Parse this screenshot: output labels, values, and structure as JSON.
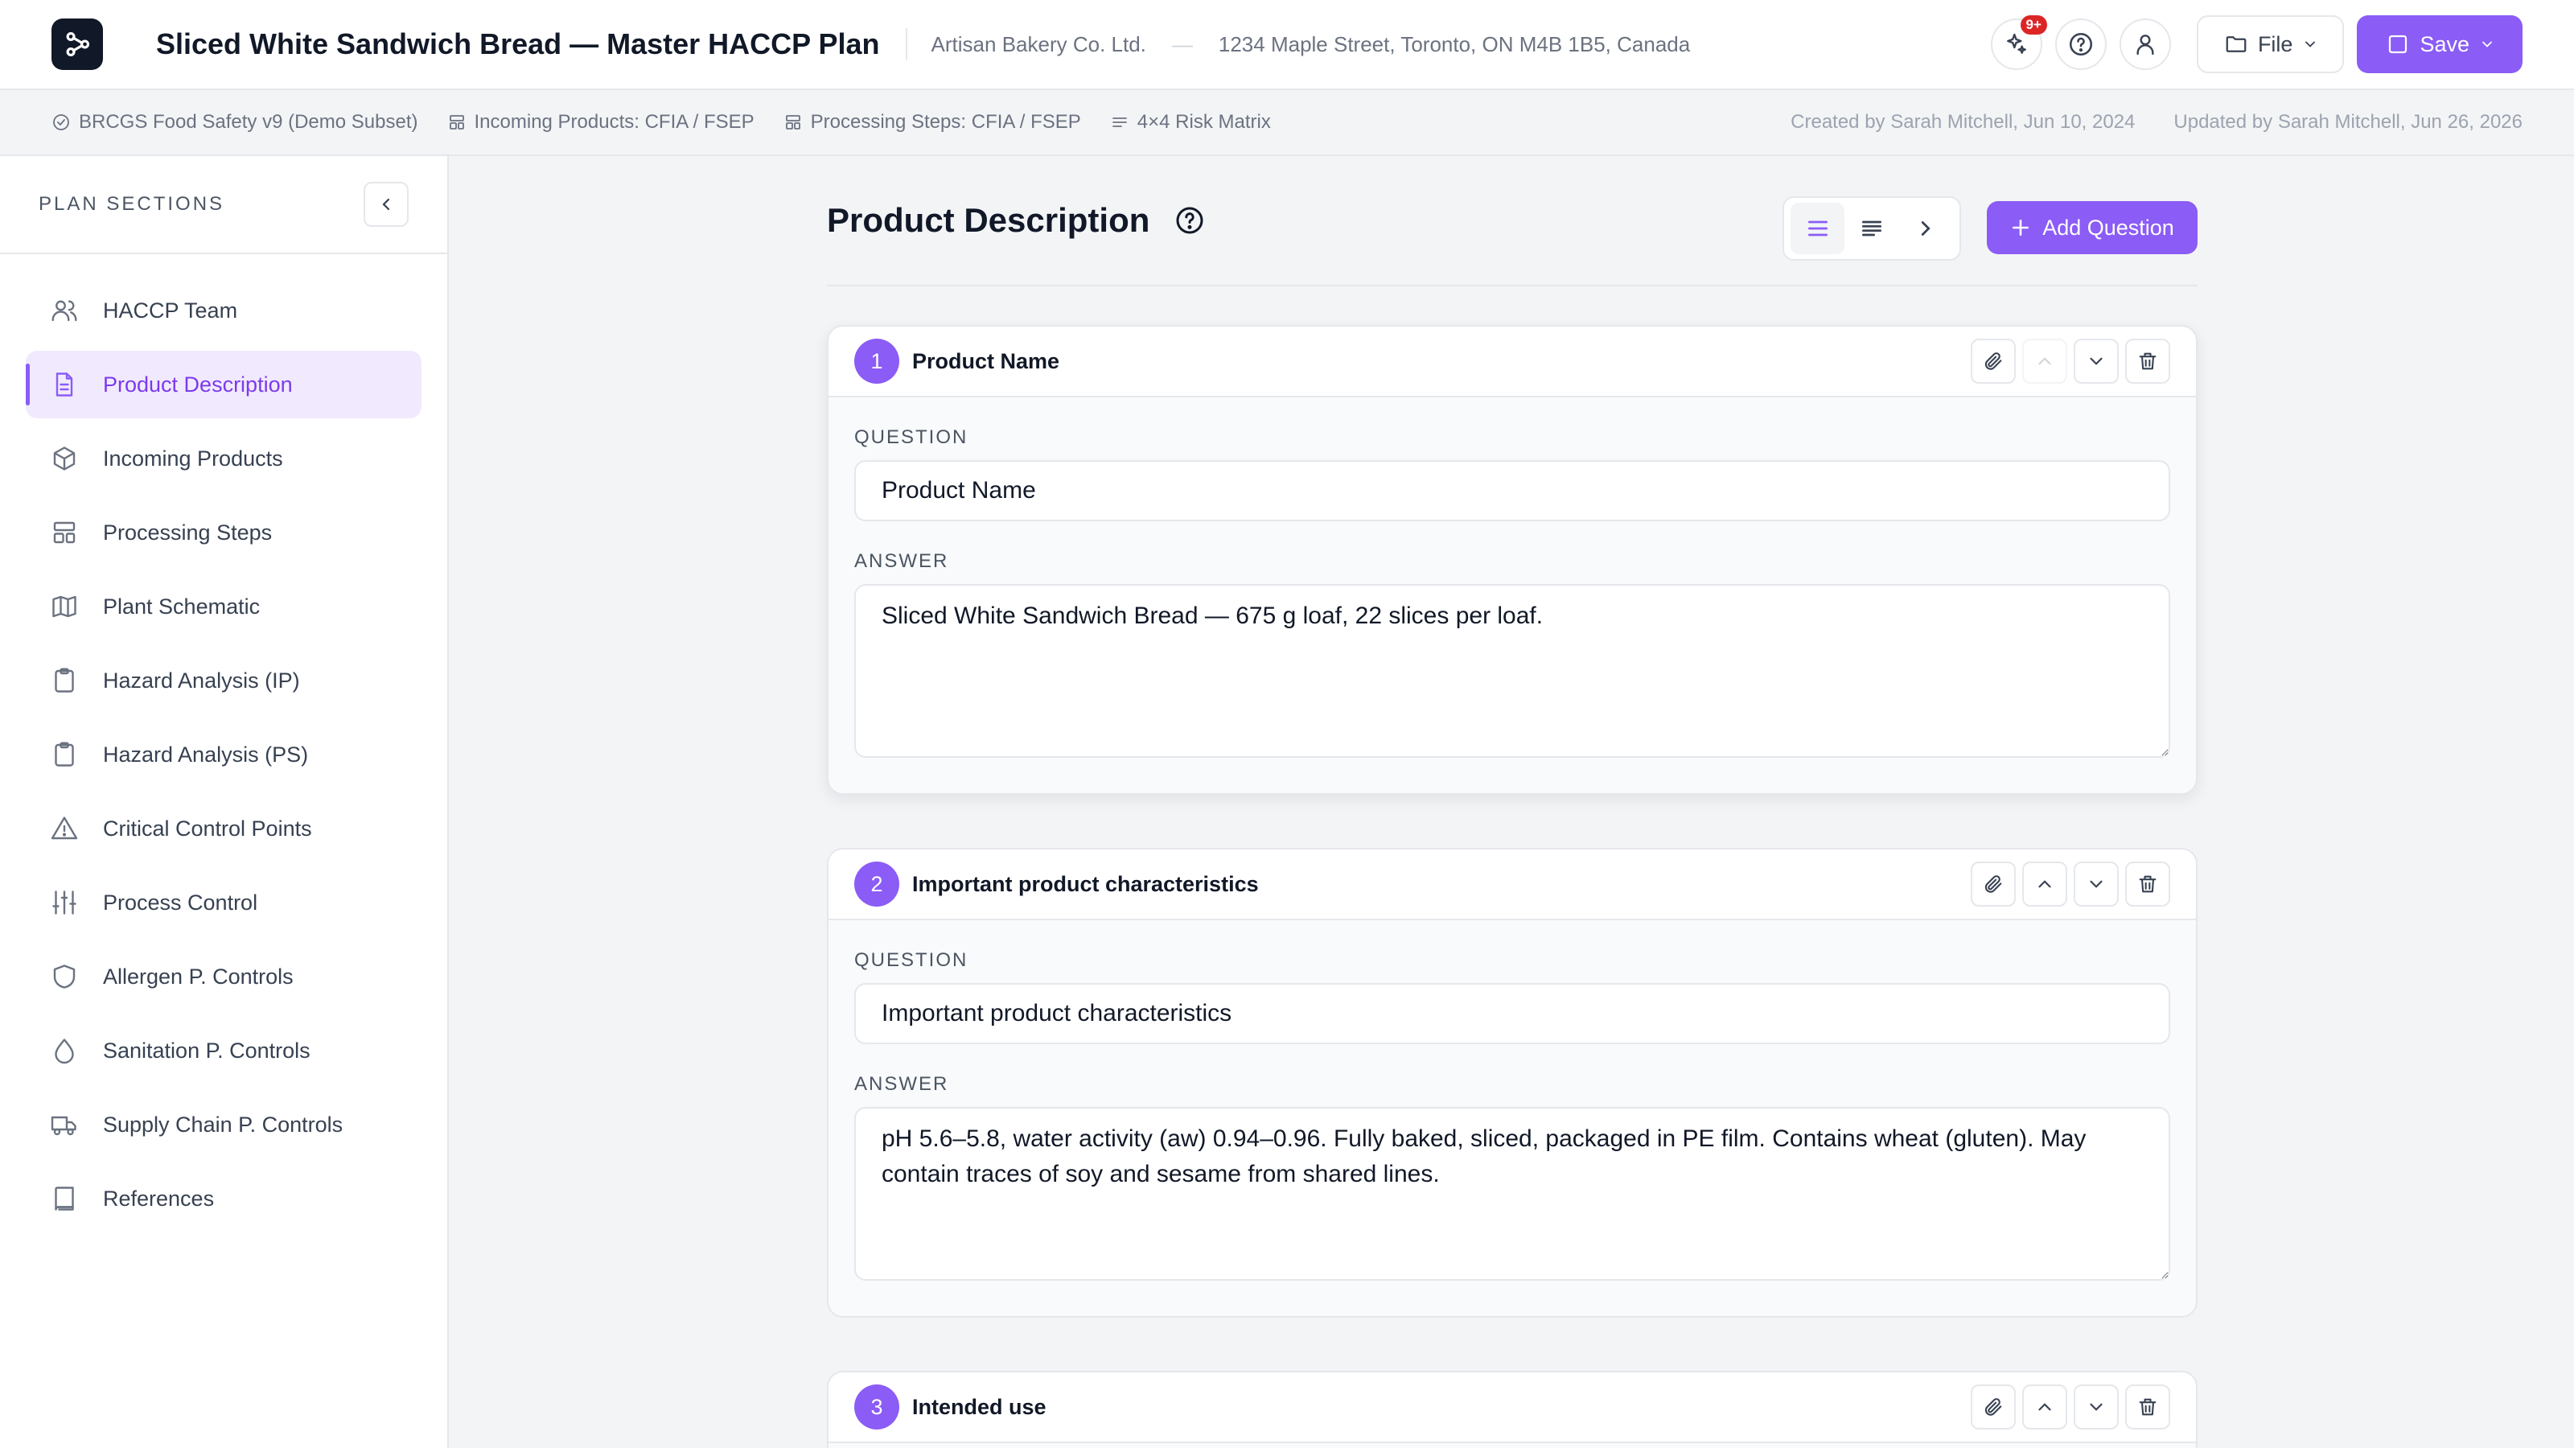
{
  "header": {
    "title": "Sliced White Sandwich Bread — Master HACCP Plan",
    "company": "Artisan Bakery Co. Ltd.",
    "separator": "—",
    "address": "1234 Maple Street, Toronto, ON M4B 1B5, Canada",
    "notification_badge": "9+",
    "file_label": "File",
    "save_label": "Save"
  },
  "meta": {
    "standard": "BRCGS Food Safety v9 (Demo Subset)",
    "incoming": "Incoming Products: CFIA / FSEP",
    "processing": "Processing Steps: CFIA / FSEP",
    "matrix": "4×4 Risk Matrix",
    "created": "Created by Sarah Mitchell, Jun 10, 2024",
    "updated": "Updated by Sarah Mitchell, Jun 26, 2026"
  },
  "sidebar": {
    "title": "PLAN SECTIONS",
    "items": [
      {
        "label": "HACCP Team",
        "icon": "users-icon"
      },
      {
        "label": "Product Description",
        "icon": "document-icon"
      },
      {
        "label": "Incoming Products",
        "icon": "package-icon"
      },
      {
        "label": "Processing Steps",
        "icon": "layout-icon"
      },
      {
        "label": "Plant Schematic",
        "icon": "map-icon"
      },
      {
        "label": "Hazard Analysis (IP)",
        "icon": "clipboard-icon"
      },
      {
        "label": "Hazard Analysis (PS)",
        "icon": "clipboard-icon"
      },
      {
        "label": "Critical Control Points",
        "icon": "warning-icon"
      },
      {
        "label": "Process Control",
        "icon": "sliders-icon"
      },
      {
        "label": "Allergen P. Controls",
        "icon": "shield-icon"
      },
      {
        "label": "Sanitation P. Controls",
        "icon": "droplet-icon"
      },
      {
        "label": "Supply Chain P. Controls",
        "icon": "truck-icon"
      },
      {
        "label": "References",
        "icon": "book-icon"
      }
    ]
  },
  "main": {
    "title": "Product Description",
    "add_label": "Add Question",
    "question_label": "QUESTION",
    "answer_label": "ANSWER",
    "cards": [
      {
        "number": "1",
        "title": "Product Name",
        "question": "Product Name",
        "answer": "Sliced White Sandwich Bread — 675 g loaf, 22 slices per loaf."
      },
      {
        "number": "2",
        "title": "Important product characteristics",
        "question": "Important product characteristics",
        "answer": "pH 5.6–5.8, water activity (aw) 0.94–0.96. Fully baked, sliced, packaged in PE film. Contains wheat (gluten). May contain traces of soy and sesame from shared lines."
      },
      {
        "number": "3",
        "title": "Intended use"
      }
    ]
  },
  "colors": {
    "accent": "#8b5cf6",
    "badge": "#dc2626"
  }
}
